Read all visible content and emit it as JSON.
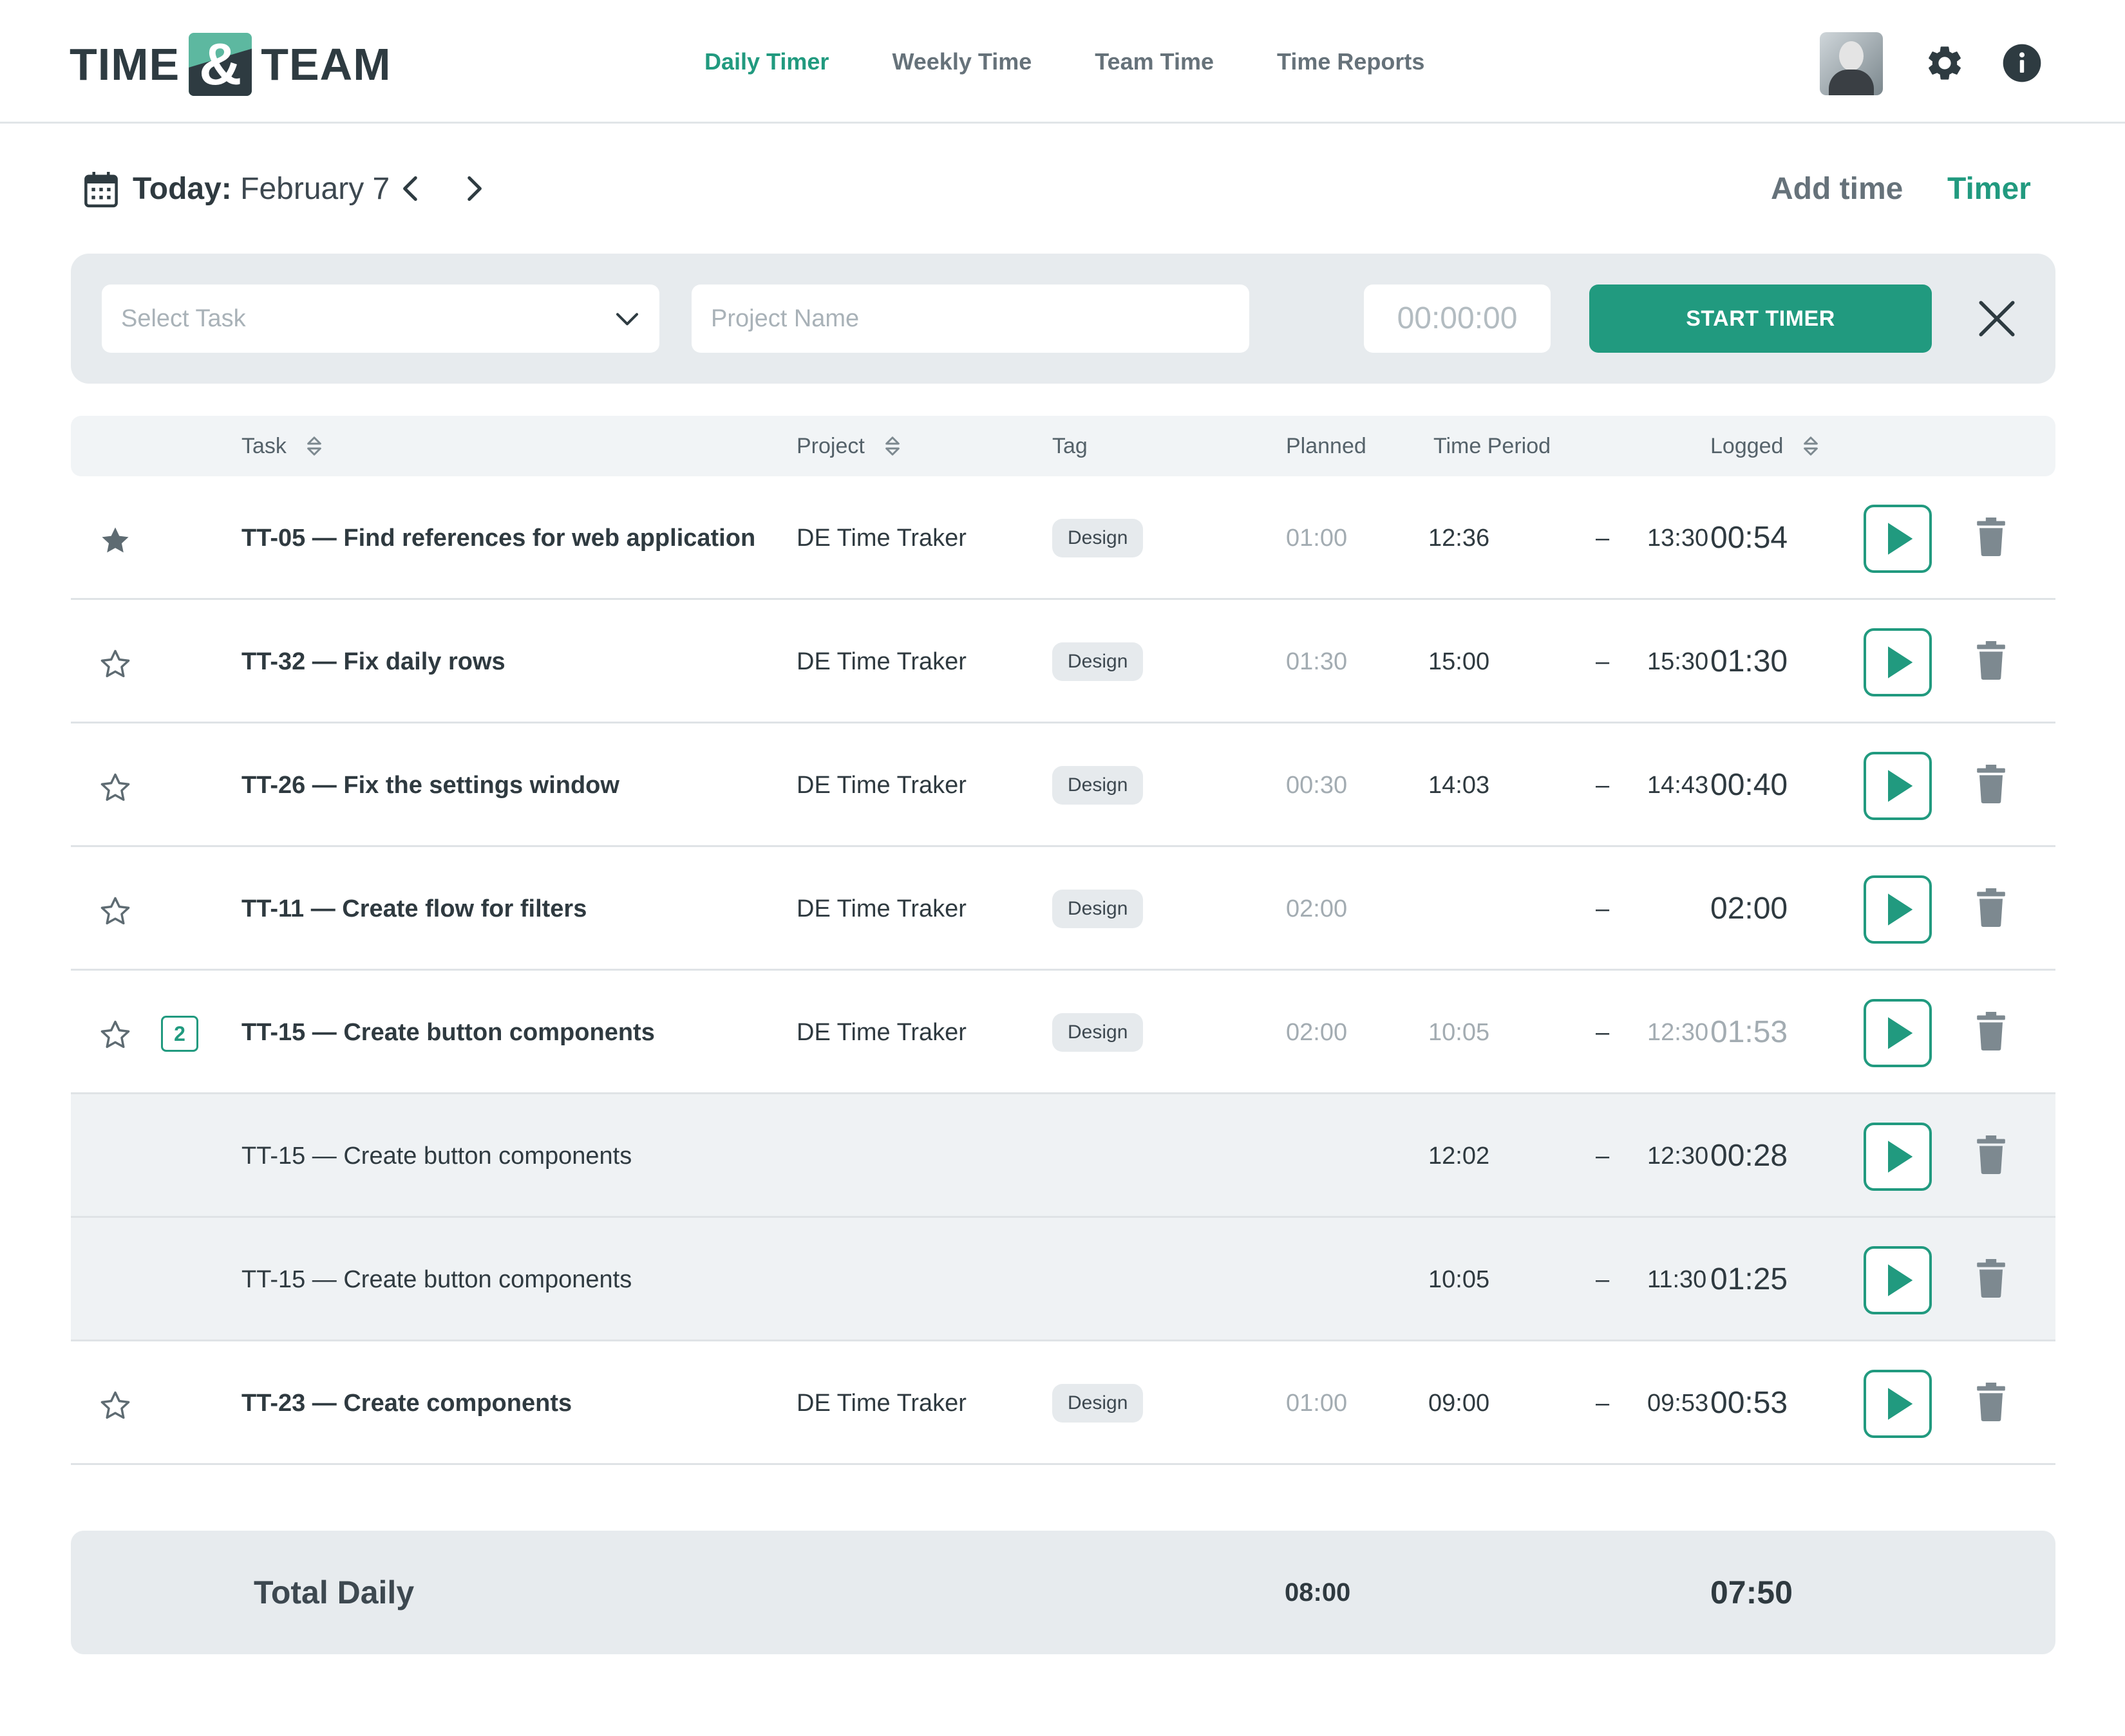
{
  "app": {
    "logo_left": "TIME",
    "logo_amp": "&",
    "logo_right": "TEAM"
  },
  "nav": [
    {
      "label": "Daily Timer",
      "active": true
    },
    {
      "label": "Weekly Time",
      "active": false
    },
    {
      "label": "Team Time",
      "active": false
    },
    {
      "label": "Time Reports",
      "active": false
    }
  ],
  "header_icons": [
    "avatar",
    "gear-icon",
    "info-icon"
  ],
  "date": {
    "prefix": "Today:",
    "value": "February 7"
  },
  "modes": {
    "add_time": "Add time",
    "timer": "Timer",
    "active": "timer"
  },
  "timer_bar": {
    "select_placeholder": "Select Task",
    "project_placeholder": "Project Name",
    "time": "00:00:00",
    "start_label": "START TIMER"
  },
  "columns": {
    "task": "Task",
    "project": "Project",
    "tag": "Tag",
    "planned": "Planned",
    "time_period": "Time Period",
    "logged": "Logged"
  },
  "rows": [
    {
      "starred": true,
      "name": "TT-05 — Find references for web application",
      "project": "DE Time Traker",
      "tag": "Design",
      "planned": "01:00",
      "start": "12:36",
      "dash": "–",
      "end": "13:30",
      "logged": "00:54"
    },
    {
      "starred": false,
      "name": "TT-32 — Fix daily rows",
      "project": "DE Time Traker",
      "tag": "Design",
      "planned": "01:30",
      "start": "15:00",
      "dash": "–",
      "end": "15:30",
      "logged": "01:30"
    },
    {
      "starred": false,
      "name": "TT-26 — Fix the settings window",
      "project": "DE Time Traker",
      "tag": "Design",
      "planned": "00:30",
      "start": "14:03",
      "dash": "–",
      "end": "14:43",
      "logged": "00:40"
    },
    {
      "starred": false,
      "name": "TT-11 — Create flow for filters",
      "project": "DE Time Traker",
      "tag": "Design",
      "planned": "02:00",
      "start": "",
      "dash": "–",
      "end": "",
      "logged": "02:00"
    },
    {
      "starred": false,
      "count": "2",
      "name": "TT-15 — Create button components",
      "project": "DE Time Traker",
      "tag": "Design",
      "planned": "02:00",
      "start": "10:05",
      "dash": "–",
      "end": "12:30",
      "logged": "01:53"
    },
    {
      "sub": true,
      "name": "TT-15 — Create button components",
      "start": "12:02",
      "dash": "–",
      "end": "12:30",
      "logged": "00:28"
    },
    {
      "sub": true,
      "name": "TT-15 — Create button components",
      "start": "10:05",
      "dash": "–",
      "end": "11:30",
      "logged": "01:25"
    },
    {
      "starred": false,
      "name": "TT-23 — Create components",
      "project": "DE Time Traker",
      "tag": "Design",
      "planned": "01:00",
      "start": "09:00",
      "dash": "–",
      "end": "09:53",
      "logged": "00:53"
    }
  ],
  "totals": {
    "label": "Total Daily",
    "planned": "08:00",
    "logged": "07:50"
  },
  "colors": {
    "accent": "#219a7f",
    "text": "#2f3a40",
    "muted": "#a3acb2",
    "panel": "#e7ebee"
  }
}
